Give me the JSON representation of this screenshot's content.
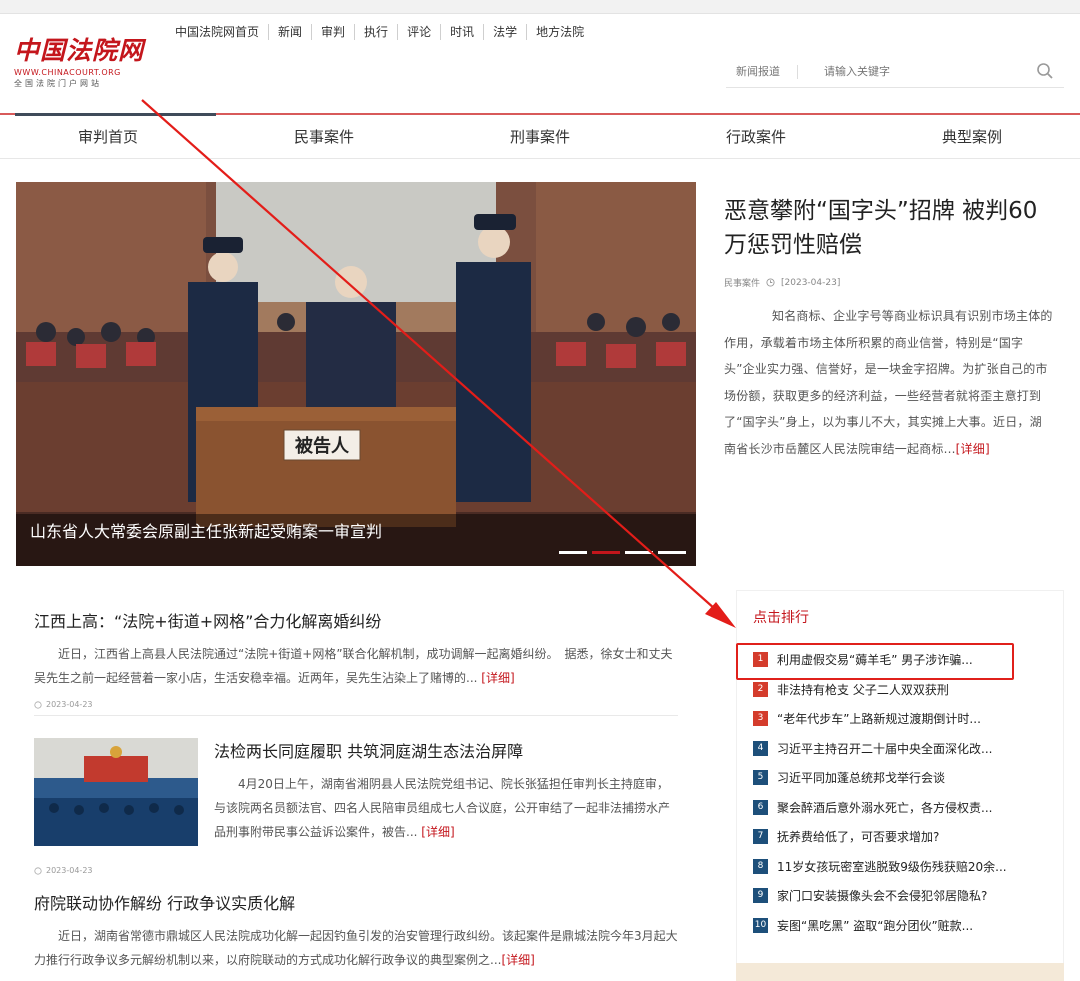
{
  "brand": {
    "logo_text": "中国法院网",
    "url": "WWW.CHINACOURT.ORG",
    "subtitle": "全国法院门户网站"
  },
  "topnav": [
    "中国法院网首页",
    "新闻",
    "审判",
    "执行",
    "评论",
    "时讯",
    "法学",
    "地方法院"
  ],
  "search": {
    "scope": "新闻报道",
    "placeholder": "请输入关键字",
    "icon": "search-icon"
  },
  "categories": [
    "审判首页",
    "民事案件",
    "刑事案件",
    "行政案件",
    "典型案例"
  ],
  "hero": {
    "caption": "山东省人大常委会原副主任张新起受贿案一审宣判",
    "sign_text": "被告人"
  },
  "featured": {
    "title": "恶意攀附“国字头”招牌 被判60万惩罚性赔偿",
    "category": "民事案件",
    "date": "[2023-04-23]",
    "summary": "知名商标、企业字号等商业标识具有识别市场主体的作用，承载着市场主体所积累的商业信誉，特别是“国字头”企业实力强、信誉好，是一块金字招牌。为扩张自己的市场份额，获取更多的经济利益，一些经营者就将歪主意打到了“国字头”身上，以为事儿不大，其实摊上大事。近日，湖南省长沙市岳麓区人民法院审结一起商标...",
    "detail": "[详细]"
  },
  "news": [
    {
      "title": "江西上高：“法院+街道+网格”合力化解离婚纠纷",
      "summary": "近日，江西省上高县人民法院通过“法院+街道+网格”联合化解机制，成功调解一起离婚纠纷。　据悉，徐女士和丈夫吴先生之前一起经营着一家小店，生活安稳幸福。近两年，吴先生沾染上了赌博的...",
      "detail": "[详细]",
      "date": "2023-04-23"
    },
    {
      "title": "法检两长同庭履职 共筑洞庭湖生态法治屏障",
      "summary": "4月20日上午，湖南省湘阴县人民法院党组书记、院长张猛担任审判长主持庭审，与该院两名员额法官、四名人民陪审员组成七人合议庭，公开审结了一起非法捕捞水产品刑事附带民事公益诉讼案件，被告...",
      "detail": "[详细]",
      "date": "2023-04-23"
    },
    {
      "title": "府院联动协作解纷 行政争议实质化解",
      "summary": "近日，湖南省常德市鼎城区人民法院成功化解一起因钓鱼引发的治安管理行政纠纷。该起案件是鼎城法院今年3月起大力推行行政争议多元解纷机制以来，以府院联动的方式成功化解行政争议的典型案例之...",
      "detail": "[详细]"
    }
  ],
  "ranking": {
    "title": "点击排行",
    "items": [
      {
        "num": "1",
        "text": "利用虚假交易“薅羊毛” 男子涉诈骗..."
      },
      {
        "num": "2",
        "text": "非法持有枪支 父子二人双双获刑"
      },
      {
        "num": "3",
        "text": "“老年代步车”上路新规过渡期倒计时..."
      },
      {
        "num": "4",
        "text": "习近平主持召开二十届中央全面深化改..."
      },
      {
        "num": "5",
        "text": "习近平同加蓬总统邦戈举行会谈"
      },
      {
        "num": "6",
        "text": "聚会醉酒后意外溺水死亡，各方侵权责..."
      },
      {
        "num": "7",
        "text": "抚养费给低了，可否要求增加?"
      },
      {
        "num": "8",
        "text": "11岁女孩玩密室逃脱致9级伤残获赔20余..."
      },
      {
        "num": "9",
        "text": "家门口安装摄像头会不会侵犯邻居隐私?"
      },
      {
        "num": "10",
        "text": "妄图“黑吃黑” 盗取“跑分团伙”赃款..."
      }
    ]
  },
  "colors": {
    "brand_red": "#c4161c",
    "highlight_red": "#e0201b",
    "rank_hot": "#d43c2c",
    "rank_cool": "#1d4f7a"
  }
}
